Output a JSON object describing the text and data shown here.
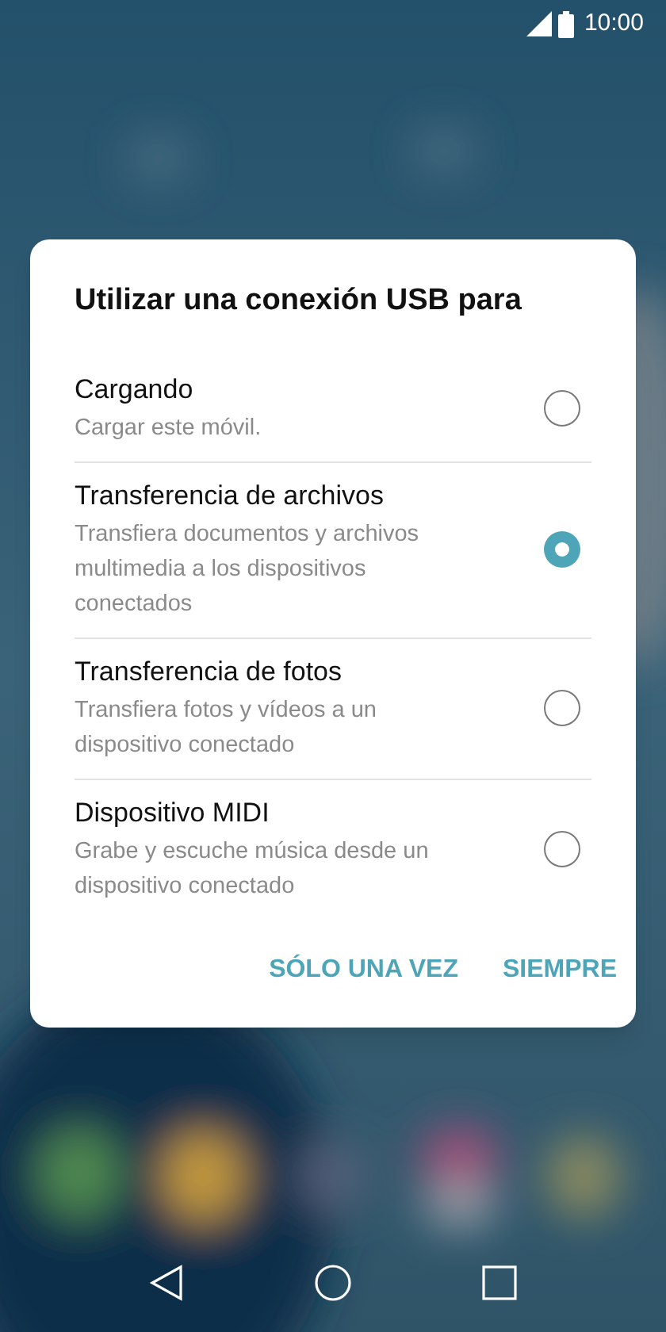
{
  "status_bar": {
    "time": "10:00"
  },
  "dialog": {
    "title": "Utilizar una conexión USB para",
    "options": [
      {
        "label": "Cargando",
        "description": "Cargar este móvil.",
        "selected": false
      },
      {
        "label": "Transferencia de archivos",
        "description": "Transfiera documentos y archivos multimedia a los dispositivos conectados",
        "selected": true
      },
      {
        "label": "Transferencia de fotos",
        "description": "Transfiera fotos y vídeos a un dispositivo conectado",
        "selected": false
      },
      {
        "label": "Dispositivo MIDI",
        "description": "Grabe y escuche música desde un dispositivo conectado",
        "selected": false
      }
    ],
    "buttons": [
      "SÓLO UNA VEZ",
      "SIEMPRE"
    ]
  }
}
